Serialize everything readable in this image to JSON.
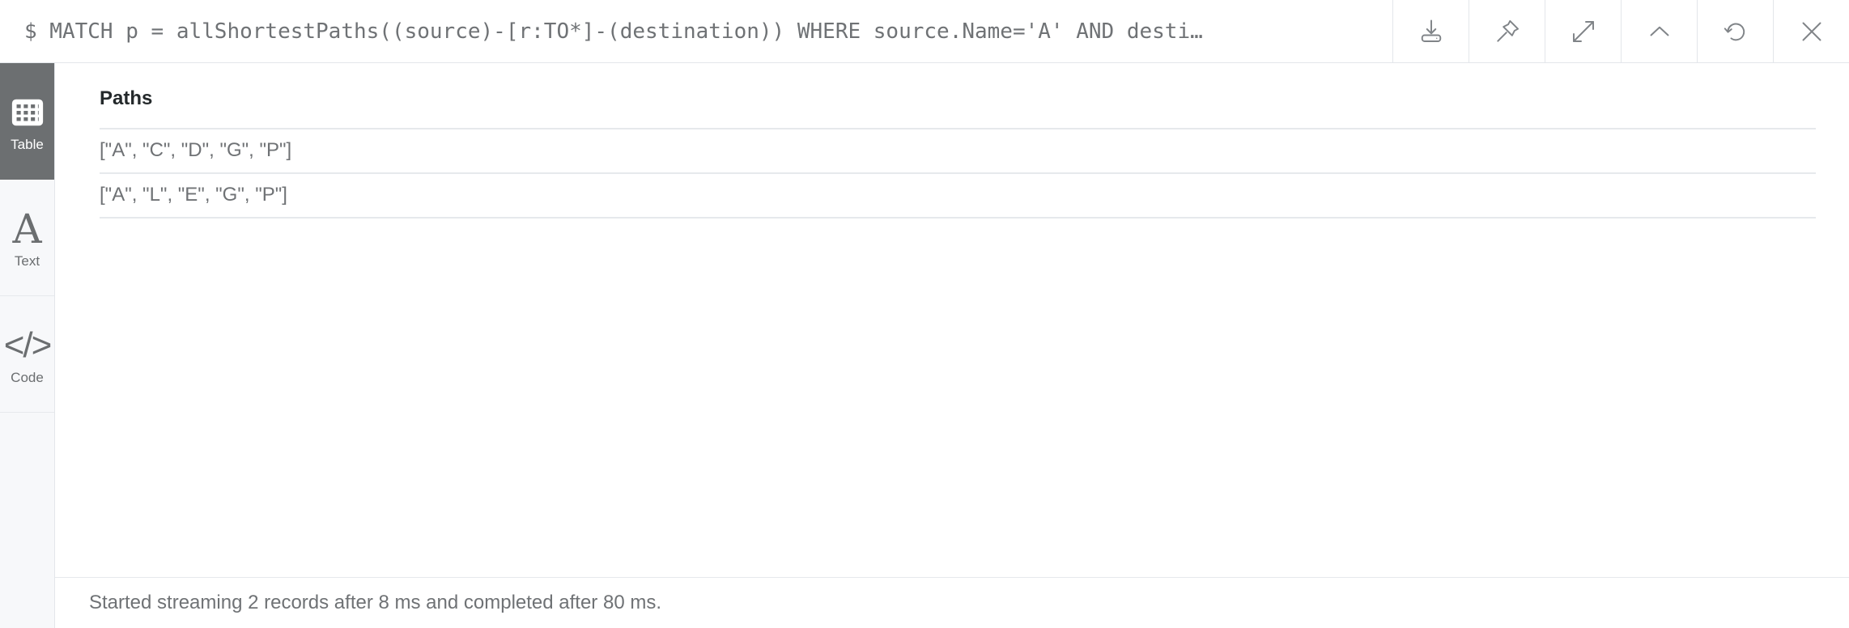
{
  "query": {
    "prompt": "$",
    "text": "$ MATCH p = allShortestPaths((source)-[r:TO*]-(destination)) WHERE source.Name='A' AND desti…"
  },
  "toolbar": {
    "buttons": [
      {
        "name": "download-icon",
        "label": "Download"
      },
      {
        "name": "pin-icon",
        "label": "Pin"
      },
      {
        "name": "expand-icon",
        "label": "Expand"
      },
      {
        "name": "chevron-up-icon",
        "label": "Collapse"
      },
      {
        "name": "refresh-icon",
        "label": "Rerun"
      },
      {
        "name": "close-icon",
        "label": "Close"
      }
    ]
  },
  "sidebar": {
    "items": [
      {
        "label": "Table",
        "icon": "table-icon",
        "active": true
      },
      {
        "label": "Text",
        "icon": "text-icon",
        "active": false
      },
      {
        "label": "Code",
        "icon": "code-icon",
        "active": false
      }
    ]
  },
  "results": {
    "columns": [
      "Paths"
    ],
    "rows": [
      [
        "[\"A\", \"C\", \"D\", \"G\", \"P\"]"
      ],
      [
        "[\"A\", \"L\", \"E\", \"G\", \"P\"]"
      ]
    ]
  },
  "status": {
    "message": "Started streaming 2 records after 8 ms and completed after 80 ms."
  },
  "colors": {
    "accent_active": "#6c6f71",
    "text_muted": "#6f7275",
    "text_strong": "#24292b",
    "border": "#e6e9ec",
    "sidebar_bg": "#f7f8fa"
  }
}
